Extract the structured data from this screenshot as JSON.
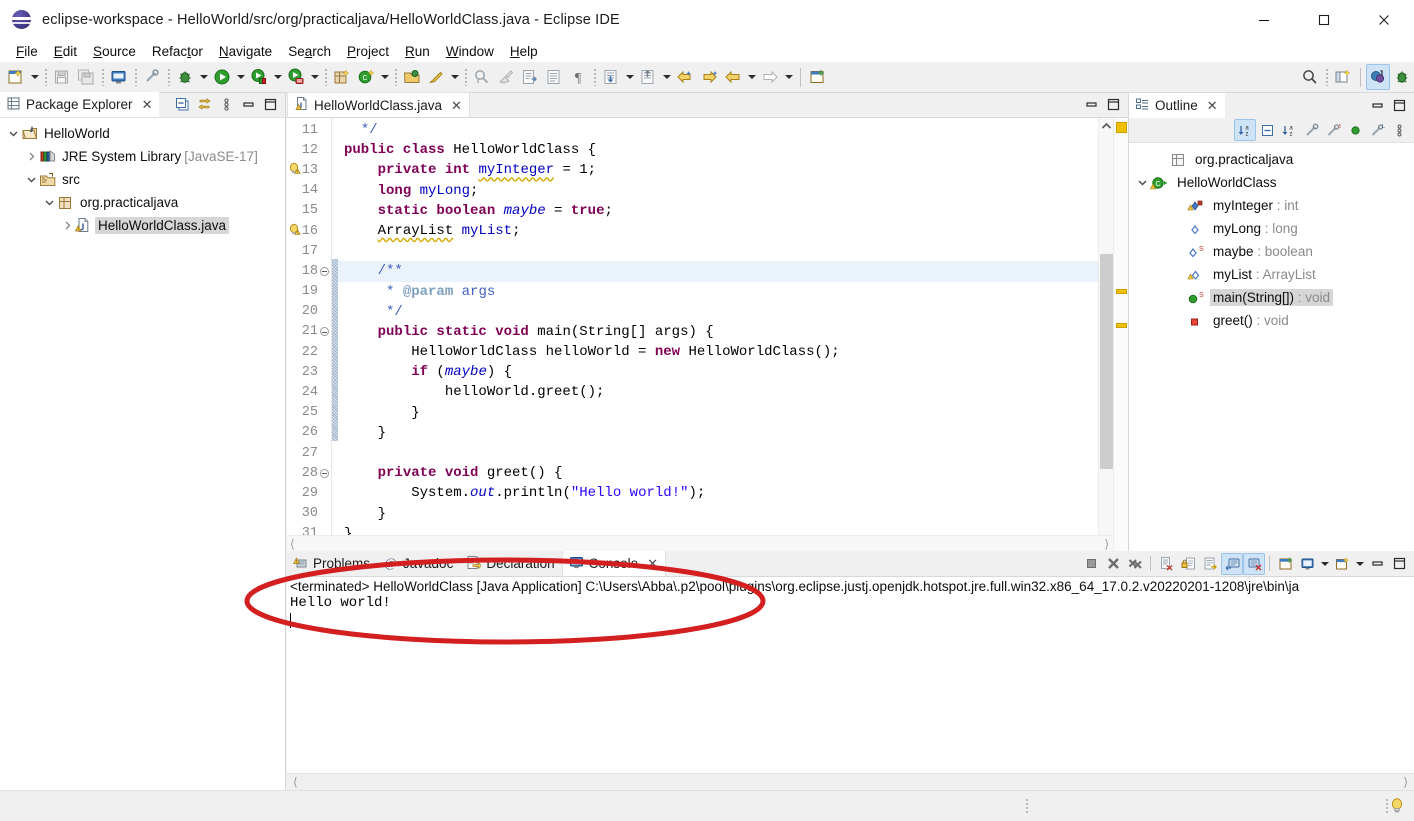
{
  "window": {
    "title": "eclipse-workspace - HelloWorld/src/org/practicaljava/HelloWorldClass.java - Eclipse IDE",
    "app_icon": "eclipse-sphere-icon",
    "minimize_label": "—",
    "maximize_label": "□",
    "close_label": "✕"
  },
  "menubar": {
    "items": [
      {
        "label": "File",
        "mnemonic": "F"
      },
      {
        "label": "Edit",
        "mnemonic": "E"
      },
      {
        "label": "Source",
        "mnemonic": "S"
      },
      {
        "label": "Refactor",
        "mnemonic": "t"
      },
      {
        "label": "Navigate",
        "mnemonic": "N"
      },
      {
        "label": "Search",
        "mnemonic": "a"
      },
      {
        "label": "Project",
        "mnemonic": "P"
      },
      {
        "label": "Run",
        "mnemonic": "R"
      },
      {
        "label": "Window",
        "mnemonic": "W"
      },
      {
        "label": "Help",
        "mnemonic": "H"
      }
    ]
  },
  "toolbar": {
    "items": [
      {
        "name": "new-wizard-icon",
        "type": "button"
      },
      {
        "name": "new-wizard-dropdown-arrow",
        "type": "arrow"
      },
      {
        "name": "separator",
        "type": "sep"
      },
      {
        "name": "save-icon",
        "type": "button"
      },
      {
        "name": "save-all-icon",
        "type": "button"
      },
      {
        "name": "separator",
        "type": "sep"
      },
      {
        "name": "print-icon",
        "type": "button"
      },
      {
        "name": "separator",
        "type": "sep"
      },
      {
        "name": "toggle-mark-occurrences-icon",
        "type": "button"
      },
      {
        "name": "separator",
        "type": "sep"
      },
      {
        "name": "debug-icon",
        "type": "button"
      },
      {
        "name": "debug-dropdown-arrow",
        "type": "arrow"
      },
      {
        "name": "run-icon",
        "type": "button"
      },
      {
        "name": "run-dropdown-arrow",
        "type": "arrow"
      },
      {
        "name": "run-coverage-icon",
        "type": "button"
      },
      {
        "name": "coverage-dropdown-arrow",
        "type": "arrow"
      },
      {
        "name": "external-tools-icon",
        "type": "button"
      },
      {
        "name": "external-tools-arrow",
        "type": "arrow"
      },
      {
        "name": "separator",
        "type": "sep"
      },
      {
        "name": "new-java-package-icon",
        "type": "button"
      },
      {
        "name": "new-java-class-icon",
        "type": "button"
      },
      {
        "name": "new-class-dropdown-arrow",
        "type": "arrow"
      },
      {
        "name": "separator",
        "type": "sep"
      },
      {
        "name": "open-type-icon",
        "type": "button"
      },
      {
        "name": "open-task-icon",
        "type": "button"
      },
      {
        "name": "open-task-arrow",
        "type": "arrow"
      },
      {
        "name": "separator",
        "type": "sep"
      },
      {
        "name": "search-declarations-icon",
        "type": "button"
      }
    ],
    "items2": [
      {
        "name": "clean-icon",
        "type": "button"
      },
      {
        "name": "next-annotation-icon",
        "type": "button"
      },
      {
        "name": "previous-annotation-icon",
        "type": "button"
      },
      {
        "name": "pilcrow-icon",
        "type": "button"
      },
      {
        "name": "separator",
        "type": "sep"
      },
      {
        "name": "next-edit-icon",
        "type": "button"
      },
      {
        "name": "next-edit-arrow",
        "type": "arrow"
      },
      {
        "name": "previous-edit-icon",
        "type": "button"
      },
      {
        "name": "previous-edit-arrow",
        "type": "arrow"
      },
      {
        "name": "back-history-icon",
        "type": "button"
      },
      {
        "name": "forward-history-icon",
        "type": "button"
      },
      {
        "name": "back-arrow-icon",
        "type": "button"
      },
      {
        "name": "back-arrow-dropdown",
        "type": "arrow"
      },
      {
        "name": "forward-arrow-icon",
        "type": "button"
      },
      {
        "name": "forward-arrow-dropdown",
        "type": "arrow"
      },
      {
        "name": "separator-line",
        "type": "sepline"
      },
      {
        "name": "new-window-icon",
        "type": "button"
      }
    ],
    "right_items": [
      {
        "name": "quick-access-search-icon",
        "type": "button"
      },
      {
        "name": "separator",
        "type": "sep"
      },
      {
        "name": "open-perspective-icon",
        "type": "button"
      },
      {
        "name": "separator-line",
        "type": "sepline"
      },
      {
        "name": "java-perspective-icon",
        "type": "button",
        "active": true
      },
      {
        "name": "debug-perspective-icon",
        "type": "button"
      }
    ]
  },
  "package_explorer": {
    "tab_label": "Package Explorer",
    "tab_icon": "package-explorer-icon",
    "close_label": "✕",
    "toolbar": [
      {
        "name": "collapse-all-icon"
      },
      {
        "name": "link-with-editor-icon"
      },
      {
        "name": "view-menu-icon"
      },
      {
        "name": "minimize-view-icon"
      },
      {
        "name": "maximize-view-icon"
      }
    ],
    "tree": [
      {
        "label": "HelloWorld",
        "depth": 0,
        "icon": "java-project-icon",
        "twisty": "down",
        "selected": false,
        "suffix": ""
      },
      {
        "label": "JRE System Library",
        "depth": 1,
        "icon": "jre-library-icon",
        "twisty": "right",
        "selected": false,
        "suffix": "[JavaSE-17]"
      },
      {
        "label": "src",
        "depth": 1,
        "icon": "source-folder-icon",
        "twisty": "down",
        "selected": false,
        "suffix": ""
      },
      {
        "label": "org.practicaljava",
        "depth": 2,
        "icon": "package-icon",
        "twisty": "down",
        "selected": false,
        "suffix": ""
      },
      {
        "label": "HelloWorldClass.java",
        "depth": 3,
        "icon": "java-file-warning-icon",
        "twisty": "right",
        "selected": true,
        "suffix": ""
      }
    ]
  },
  "editor": {
    "tab_label": "HelloWorldClass.java",
    "tab_icon": "java-file-warning-icon",
    "close_label": "✕",
    "minimize_label": "minimize-icon",
    "maximize_label": "maximize-icon",
    "first_line": 11,
    "lines": [
      {
        "num": 11,
        "fold": false,
        "warn": false,
        "highlight": false,
        "tokens": [
          {
            "t": "  ",
            "c": ""
          },
          {
            "t": "*/",
            "c": "cmt-doc"
          }
        ]
      },
      {
        "num": 12,
        "fold": false,
        "warn": false,
        "highlight": false,
        "tokens": [
          {
            "t": "public class ",
            "c": "kw"
          },
          {
            "t": "HelloWorldClass {",
            "c": ""
          }
        ]
      },
      {
        "num": 13,
        "fold": false,
        "warn": true,
        "highlight": false,
        "tokens": [
          {
            "t": "    ",
            "c": ""
          },
          {
            "t": "private int ",
            "c": "kw"
          },
          {
            "t": "myInteger",
            "c": "fld sq"
          },
          {
            "t": " = 1;",
            "c": ""
          }
        ]
      },
      {
        "num": 14,
        "fold": false,
        "warn": false,
        "highlight": false,
        "tokens": [
          {
            "t": "    ",
            "c": ""
          },
          {
            "t": "long ",
            "c": "kw"
          },
          {
            "t": "myLong",
            "c": "fld"
          },
          {
            "t": ";",
            "c": ""
          }
        ]
      },
      {
        "num": 15,
        "fold": false,
        "warn": false,
        "highlight": false,
        "tokens": [
          {
            "t": "    ",
            "c": ""
          },
          {
            "t": "static boolean ",
            "c": "kw"
          },
          {
            "t": "maybe",
            "c": "sfld"
          },
          {
            "t": " = ",
            "c": ""
          },
          {
            "t": "true",
            "c": "kw"
          },
          {
            "t": ";",
            "c": ""
          }
        ]
      },
      {
        "num": 16,
        "fold": false,
        "warn": true,
        "highlight": false,
        "tokens": [
          {
            "t": "    ",
            "c": ""
          },
          {
            "t": "ArrayList",
            "c": "sq"
          },
          {
            "t": " ",
            "c": ""
          },
          {
            "t": "myList",
            "c": "fld"
          },
          {
            "t": ";",
            "c": ""
          }
        ]
      },
      {
        "num": 17,
        "fold": false,
        "warn": false,
        "highlight": false,
        "tokens": [
          {
            "t": "",
            "c": ""
          }
        ]
      },
      {
        "num": 18,
        "fold": true,
        "warn": false,
        "highlight": true,
        "tokens": [
          {
            "t": "    ",
            "c": ""
          },
          {
            "t": "/**",
            "c": "cmt-doc"
          }
        ]
      },
      {
        "num": 19,
        "fold": false,
        "warn": false,
        "highlight": false,
        "tokens": [
          {
            "t": "     ",
            "c": ""
          },
          {
            "t": "* ",
            "c": "cmt-doc"
          },
          {
            "t": "@param",
            "c": "cmt-tag"
          },
          {
            "t": " args",
            "c": "cmt-doc"
          }
        ]
      },
      {
        "num": 20,
        "fold": false,
        "warn": false,
        "highlight": false,
        "tokens": [
          {
            "t": "     ",
            "c": ""
          },
          {
            "t": "*/",
            "c": "cmt-doc"
          }
        ]
      },
      {
        "num": 21,
        "fold": true,
        "warn": false,
        "highlight": false,
        "tokens": [
          {
            "t": "    ",
            "c": ""
          },
          {
            "t": "public static void ",
            "c": "kw"
          },
          {
            "t": "main(String[] args) {",
            "c": ""
          }
        ]
      },
      {
        "num": 22,
        "fold": false,
        "warn": false,
        "highlight": false,
        "tokens": [
          {
            "t": "        HelloWorldClass helloWorld = ",
            "c": ""
          },
          {
            "t": "new",
            "c": "kw"
          },
          {
            "t": " HelloWorldClass();",
            "c": ""
          }
        ]
      },
      {
        "num": 23,
        "fold": false,
        "warn": false,
        "highlight": false,
        "tokens": [
          {
            "t": "        ",
            "c": ""
          },
          {
            "t": "if",
            "c": "kw"
          },
          {
            "t": " (",
            "c": ""
          },
          {
            "t": "maybe",
            "c": "sfld"
          },
          {
            "t": ") {",
            "c": ""
          }
        ]
      },
      {
        "num": 24,
        "fold": false,
        "warn": false,
        "highlight": false,
        "tokens": [
          {
            "t": "            helloWorld.greet();",
            "c": ""
          }
        ]
      },
      {
        "num": 25,
        "fold": false,
        "warn": false,
        "highlight": false,
        "tokens": [
          {
            "t": "        }",
            "c": ""
          }
        ]
      },
      {
        "num": 26,
        "fold": false,
        "warn": false,
        "highlight": false,
        "tokens": [
          {
            "t": "    }",
            "c": ""
          }
        ]
      },
      {
        "num": 27,
        "fold": false,
        "warn": false,
        "highlight": false,
        "tokens": [
          {
            "t": "",
            "c": ""
          }
        ]
      },
      {
        "num": 28,
        "fold": true,
        "warn": false,
        "highlight": false,
        "tokens": [
          {
            "t": "    ",
            "c": ""
          },
          {
            "t": "private void ",
            "c": "kw"
          },
          {
            "t": "greet() {",
            "c": ""
          }
        ]
      },
      {
        "num": 29,
        "fold": false,
        "warn": false,
        "highlight": false,
        "tokens": [
          {
            "t": "        System.",
            "c": ""
          },
          {
            "t": "out",
            "c": "sfld"
          },
          {
            "t": ".println(",
            "c": ""
          },
          {
            "t": "\"Hello world!\"",
            "c": "str"
          },
          {
            "t": ");",
            "c": ""
          }
        ]
      },
      {
        "num": 30,
        "fold": false,
        "warn": false,
        "highlight": false,
        "tokens": [
          {
            "t": "    }",
            "c": ""
          }
        ]
      },
      {
        "num": 31,
        "fold": false,
        "warn": false,
        "highlight": false,
        "tokens": [
          {
            "t": "}",
            "c": ""
          }
        ]
      }
    ]
  },
  "outline": {
    "tab_label": "Outline",
    "tab_icon": "outline-icon",
    "close_label": "✕",
    "toolbar": [
      {
        "name": "sort-icon",
        "selected": true
      },
      {
        "name": "collapse-all-icon",
        "selected": false
      },
      {
        "name": "hide-fields-icon",
        "selected": false
      },
      {
        "name": "hide-static-icon",
        "selected": false
      },
      {
        "name": "hide-nonpublic-icon",
        "selected": false
      },
      {
        "name": "hide-local-types-icon",
        "selected": false
      },
      {
        "name": "hide-local-icon",
        "selected": false
      },
      {
        "name": "view-menu-icon",
        "selected": false
      }
    ],
    "minimize_label": "minimize-icon",
    "maximize_label": "maximize-icon",
    "items": [
      {
        "label": "org.practicaljava",
        "type": "",
        "depth": 1,
        "icon": "package-icon",
        "twisty": "",
        "selected": false
      },
      {
        "label": "HelloWorldClass",
        "type": "",
        "depth": 0,
        "icon": "class-warning-icon",
        "twisty": "down",
        "selected": false
      },
      {
        "label": "myInteger",
        "type": "int",
        "depth": 2,
        "icon": "private-field-warning-icon",
        "twisty": "",
        "selected": false
      },
      {
        "label": "myLong",
        "type": "long",
        "depth": 2,
        "icon": "default-field-icon",
        "twisty": "",
        "selected": false
      },
      {
        "label": "maybe",
        "type": "boolean",
        "depth": 2,
        "icon": "static-field-icon",
        "twisty": "",
        "selected": false
      },
      {
        "label": "myList",
        "type": "ArrayList",
        "depth": 2,
        "icon": "field-warning-icon",
        "twisty": "",
        "selected": false
      },
      {
        "label": "main(String[])",
        "type": "void",
        "depth": 2,
        "icon": "public-static-method-icon",
        "twisty": "",
        "selected": true
      },
      {
        "label": "greet()",
        "type": "void",
        "depth": 2,
        "icon": "private-method-icon",
        "twisty": "",
        "selected": false
      }
    ]
  },
  "console_panel": {
    "tabs": [
      {
        "label": "Problems",
        "icon": "problems-icon",
        "active": false,
        "closable": false
      },
      {
        "label": "Javadoc",
        "icon": "javadoc-icon",
        "active": false,
        "closable": false
      },
      {
        "label": "Declaration",
        "icon": "declaration-icon",
        "active": false,
        "closable": false
      },
      {
        "label": "Console",
        "icon": "console-icon",
        "active": true,
        "closable": true
      }
    ],
    "close_label": "✕",
    "toolbar": [
      {
        "name": "terminate-icon",
        "selected": false
      },
      {
        "name": "remove-launch-icon",
        "selected": false
      },
      {
        "name": "remove-all-launches-icon",
        "selected": false
      },
      {
        "name": "separator-line",
        "selected": false
      },
      {
        "name": "clear-console-icon",
        "selected": false
      },
      {
        "name": "scroll-lock-icon",
        "selected": false
      },
      {
        "name": "word-wrap-icon",
        "selected": false
      },
      {
        "name": "show-console-on-output-icon",
        "selected": true
      },
      {
        "name": "show-console-on-error-icon",
        "selected": true
      },
      {
        "name": "separator-line",
        "selected": false
      },
      {
        "name": "pin-console-icon",
        "selected": false
      },
      {
        "name": "display-selected-console-icon",
        "selected": false
      },
      {
        "name": "display-console-arrow",
        "selected": false
      },
      {
        "name": "open-console-icon",
        "selected": false
      },
      {
        "name": "open-console-arrow",
        "selected": false
      },
      {
        "name": "minimize-icon",
        "selected": false
      },
      {
        "name": "maximize-icon",
        "selected": false
      }
    ],
    "terminated_line": "<terminated> HelloWorldClass [Java Application] C:\\Users\\Abba\\.p2\\pool\\plugins\\org.eclipse.justj.openjdk.hotspot.jre.full.win32.x86_64_17.0.2.v20220201-1208\\jre\\bin\\ja",
    "output": "Hello world!"
  },
  "statusbar": {
    "bulb_icon": "quick-fix-bulb-icon"
  },
  "annotation": {
    "shape": "red-ellipse-highlight",
    "color": "#d41f20",
    "target": "console-output-area"
  },
  "colors": {
    "keyword": "#7f0055",
    "string": "#2a00ff",
    "javadoc": "#3f5fbf",
    "javadoc_tag": "#7f9fbf",
    "field": "#0000c0",
    "warning_squiggle": "#d4aa00",
    "selection": "#d6d6d6",
    "highlight_line": "#eaf2fb",
    "accent_blue": "#cfe3f7",
    "annotation_red": "#d41f20"
  }
}
